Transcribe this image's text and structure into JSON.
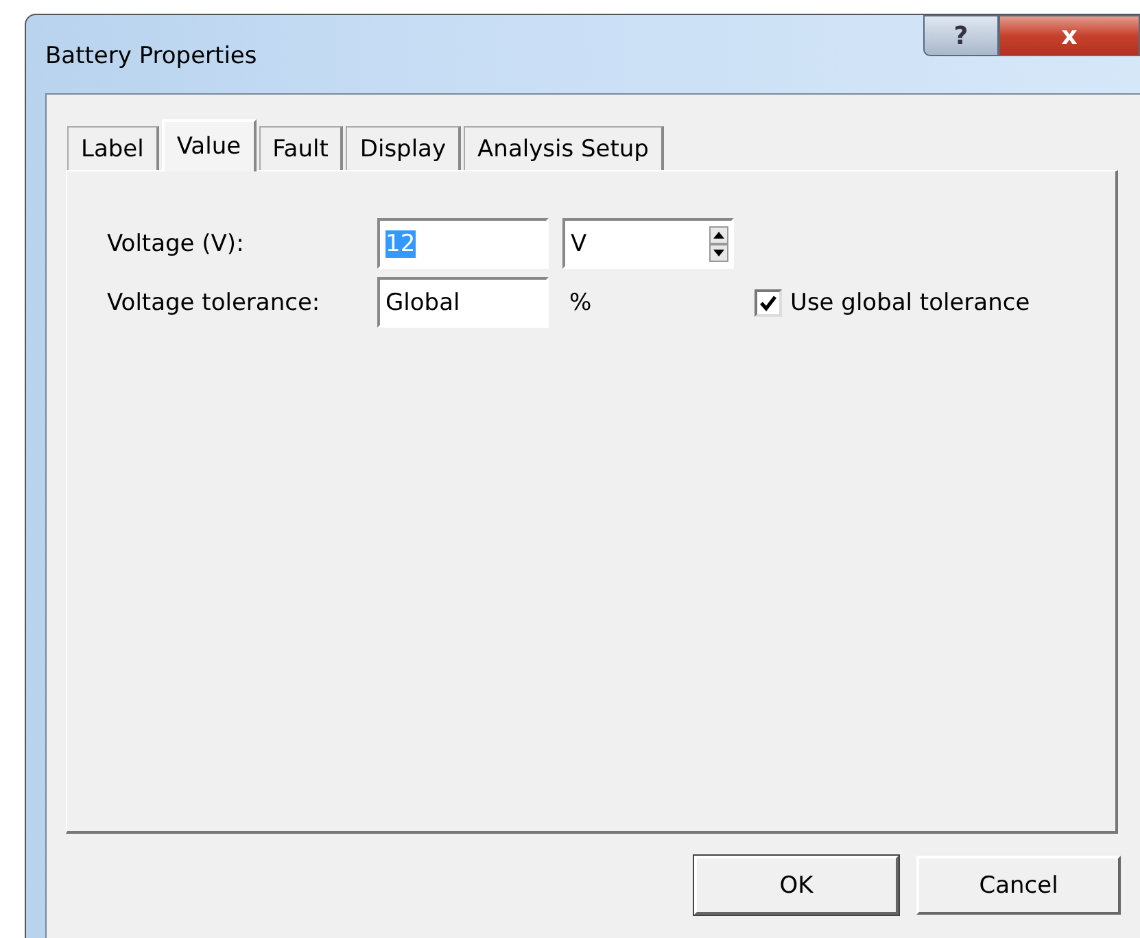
{
  "window": {
    "title": "Battery Properties",
    "help_button": "?",
    "close_button": "x"
  },
  "tabs": [
    {
      "label": "Label",
      "selected": false
    },
    {
      "label": "Value",
      "selected": true
    },
    {
      "label": "Fault",
      "selected": false
    },
    {
      "label": "Display",
      "selected": false
    },
    {
      "label": "Analysis Setup",
      "selected": false
    }
  ],
  "fields": [
    {
      "label": "Voltage (V):",
      "value": "12",
      "unit": "V",
      "kind": "spinner"
    },
    {
      "label": "Voltage tolerance:",
      "value": "Global",
      "unit": "%",
      "kind": "text"
    }
  ],
  "checkbox": {
    "label": "Use global tolerance",
    "checked": true
  },
  "buttons": [
    "OK",
    "Cancel"
  ]
}
